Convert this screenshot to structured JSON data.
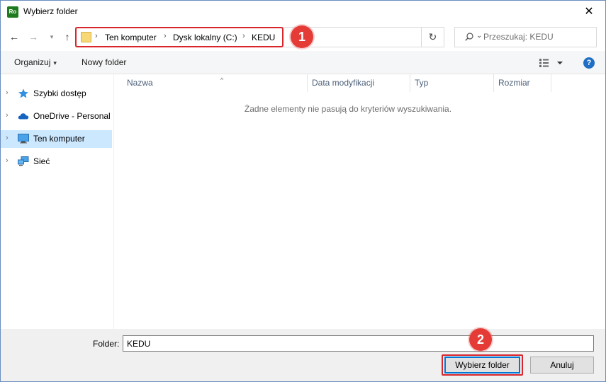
{
  "window": {
    "title": "Wybierz folder",
    "app_icon_text": "Ro",
    "close_glyph": "✕"
  },
  "nav": {
    "back_glyph": "←",
    "forward_glyph": "→",
    "recent_glyph": "▾",
    "up_glyph": "↑",
    "breadcrumbs": [
      "Ten komputer",
      "Dysk lokalny (C:)",
      "KEDU"
    ],
    "separator": "›",
    "dropdown_glyph": "⌄",
    "refresh_glyph": "↻",
    "search_placeholder": "Przeszukaj: KEDU"
  },
  "badges": [
    "1",
    "2"
  ],
  "toolbar": {
    "organize_label": "Organizuj",
    "organize_caret": "▾",
    "new_folder_label": "Nowy folder",
    "help_glyph": "?"
  },
  "sidebar": {
    "items": [
      {
        "label": "Szybki dostęp",
        "icon": "star-icon",
        "selected": false
      },
      {
        "label": "OneDrive - Personal",
        "icon": "cloud-icon",
        "selected": false
      },
      {
        "label": "Ten komputer",
        "icon": "computer-icon",
        "selected": true
      },
      {
        "label": "Sieć",
        "icon": "network-icon",
        "selected": false
      }
    ],
    "chevron": "›"
  },
  "list": {
    "columns": [
      "Nazwa",
      "Data modyfikacji",
      "Typ",
      "Rozmiar"
    ],
    "sort_glyph": "^",
    "empty_message": "Żadne elementy nie pasują do kryteriów wyszukiwania."
  },
  "footer": {
    "folder_label": "Folder:",
    "folder_value": "KEDU",
    "select_button": "Wybierz folder",
    "cancel_button": "Anuluj"
  },
  "colors": {
    "highlight_red": "#d9262c",
    "badge_red": "#e53b36",
    "selection_blue": "#cce8ff",
    "accent_blue": "#0078d7"
  }
}
